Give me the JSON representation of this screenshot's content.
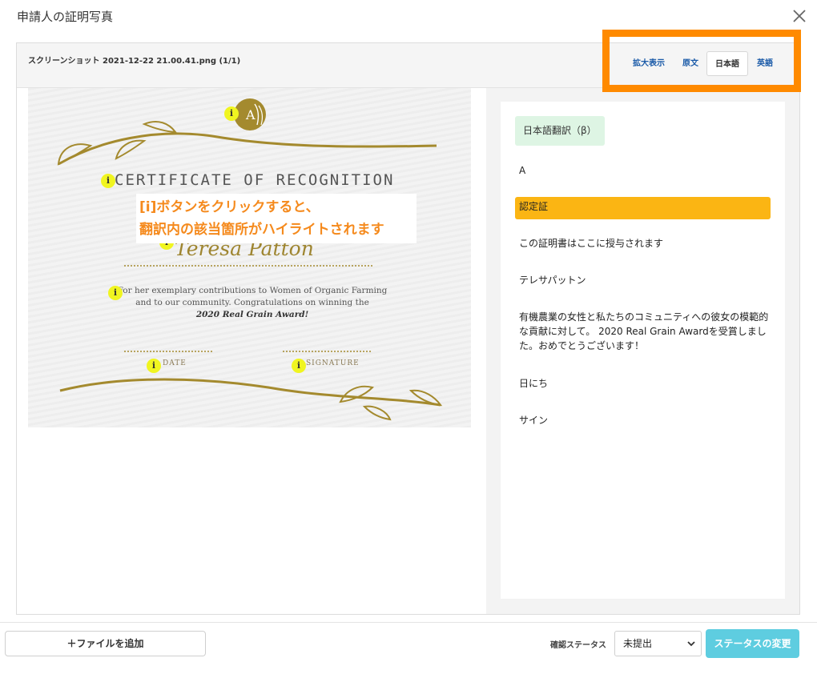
{
  "dialog": {
    "title": "申請人の証明写真"
  },
  "viewer": {
    "file_name": "スクリーンショット 2021-12-22 21.00.41.png (1/1)",
    "tabs": [
      {
        "label": "拡大表示",
        "active": false
      },
      {
        "label": "原文",
        "active": false
      },
      {
        "label": "日本語",
        "active": true
      },
      {
        "label": "英語",
        "active": false
      }
    ]
  },
  "certificate": {
    "emblem_letter": "A",
    "heading": "CERTIFICATE OF RECOGNITION",
    "recipient": "Teresa Patton",
    "body_line1": "For her exemplary contributions to Women of Organic Farming",
    "body_line2": "and to our community. Congratulations on winning the",
    "award": "2020 Real Grain Award!",
    "date_label": "DATE",
    "signature_label": "SIGNATURE",
    "info_marker": "i"
  },
  "callout": {
    "line1": "[i]ボタンをクリックすると、",
    "line2": "翻訳内の該当箇所がハイライトされます"
  },
  "translation": {
    "tag": "日本語翻訳（β）",
    "items": [
      "A",
      "認定証",
      "この証明書はここに授与されます",
      "テレサパットン",
      "有機農業の女性と私たちのコミュニティへの彼女の模範的な貢献に対して。 2020 Real Grain Awardを受賞しました。おめでとうございます！",
      "日にち",
      "サイン"
    ]
  },
  "footer": {
    "add_file_label": "＋ファイルを追加",
    "status_label": "確認ステータス",
    "status_value": "未提出",
    "change_status_label": "ステータスの変更"
  },
  "colors": {
    "highlight_box": "#ff8a00",
    "active_translation": "#fbb513",
    "translation_tag": "#def5e4",
    "primary_button": "#5ecde0",
    "info_marker": "#f0f520",
    "gold": "#a48a2e"
  }
}
